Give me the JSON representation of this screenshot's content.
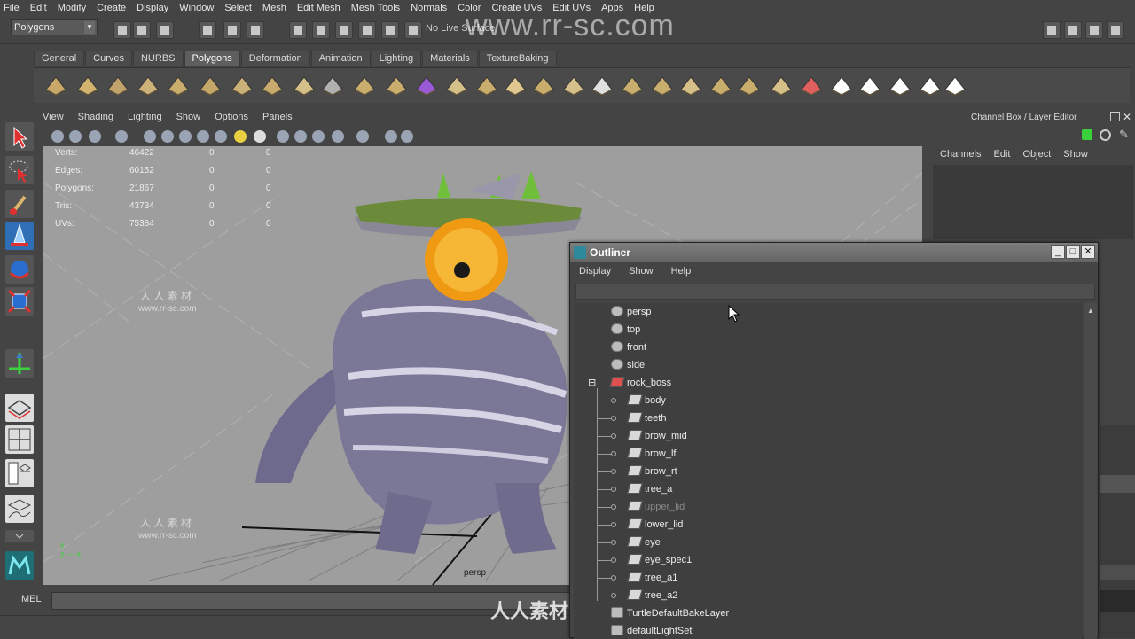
{
  "menubar": [
    "File",
    "Edit",
    "Modify",
    "Create",
    "Display",
    "Window",
    "Select",
    "Mesh",
    "Edit Mesh",
    "Mesh Tools",
    "Normals",
    "Color",
    "Create UVs",
    "Edit UVs",
    "Apps",
    "Help"
  ],
  "status": {
    "mode": "Polygons",
    "live_surface": "No Live Surface"
  },
  "watermark": "www.rr-sc.com",
  "shelf_tabs": [
    "General",
    "Curves",
    "NURBS",
    "Polygons",
    "Deformation",
    "Animation",
    "Lighting",
    "Materials",
    "TextureBaking"
  ],
  "shelf_active": "Polygons",
  "panel_menu": [
    "View",
    "Shading",
    "Lighting",
    "Show",
    "Options",
    "Panels"
  ],
  "hud": {
    "rows": [
      {
        "label": "Verts:",
        "v1": "46422",
        "v2": "0",
        "v3": "0"
      },
      {
        "label": "Edges:",
        "v1": "60152",
        "v2": "0",
        "v3": "0"
      },
      {
        "label": "Polygons:",
        "v1": "21867",
        "v2": "0",
        "v3": "0"
      },
      {
        "label": "Tris:",
        "v1": "43734",
        "v2": "0",
        "v3": "0"
      },
      {
        "label": "UVs:",
        "v1": "75384",
        "v2": "0",
        "v3": "0"
      }
    ],
    "camera": "persp"
  },
  "viewport_watermarks": {
    "cn": "人 人 素 材",
    "url": "www.rr-sc.com"
  },
  "channel_box": {
    "title": "Channel Box / Layer Editor",
    "menu": [
      "Channels",
      "Edit",
      "Object",
      "Show"
    ]
  },
  "mel": {
    "label": "MEL"
  },
  "outliner": {
    "title": "Outliner",
    "menu": [
      "Display",
      "Show",
      "Help"
    ],
    "items": [
      {
        "label": "persp",
        "kind": "camera",
        "depth": 0
      },
      {
        "label": "top",
        "kind": "camera",
        "depth": 0
      },
      {
        "label": "front",
        "kind": "camera",
        "depth": 0
      },
      {
        "label": "side",
        "kind": "camera",
        "depth": 0
      },
      {
        "label": "rock_boss",
        "kind": "group",
        "depth": 0,
        "expander": "⊟"
      },
      {
        "label": "body",
        "kind": "mesh",
        "depth": 1
      },
      {
        "label": "teeth",
        "kind": "mesh",
        "depth": 1
      },
      {
        "label": "brow_mid",
        "kind": "mesh",
        "depth": 1
      },
      {
        "label": "brow_lf",
        "kind": "mesh",
        "depth": 1
      },
      {
        "label": "brow_rt",
        "kind": "mesh",
        "depth": 1
      },
      {
        "label": "tree_a",
        "kind": "mesh",
        "depth": 1
      },
      {
        "label": "upper_lid",
        "kind": "mesh",
        "depth": 1,
        "dim": true
      },
      {
        "label": "lower_lid",
        "kind": "mesh",
        "depth": 1
      },
      {
        "label": "eye",
        "kind": "mesh",
        "depth": 1
      },
      {
        "label": "eye_spec1",
        "kind": "mesh",
        "depth": 1
      },
      {
        "label": "tree_a1",
        "kind": "mesh",
        "depth": 1
      },
      {
        "label": "tree_a2",
        "kind": "mesh",
        "depth": 1
      },
      {
        "label": "TurtleDefaultBakeLayer",
        "kind": "set",
        "depth": 0
      },
      {
        "label": "defaultLightSet",
        "kind": "set",
        "depth": 0
      }
    ]
  },
  "overlay_watermark": "人人素材"
}
